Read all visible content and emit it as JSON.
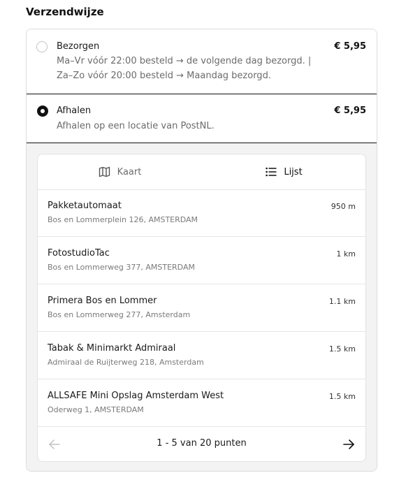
{
  "section_title": "Verzendwijze",
  "options": [
    {
      "label": "Bezorgen",
      "price": "€ 5,95",
      "description_line1": "Ma–Vr vóór 22:00 besteld → de volgende dag bezorgd. |",
      "description_line2": "Za–Zo vóór 20:00 besteld → Maandag bezorgd.",
      "selected": false
    },
    {
      "label": "Afhalen",
      "price": "€ 5,95",
      "description": "Afhalen op een locatie van PostNL.",
      "selected": true
    }
  ],
  "tabs": {
    "map": {
      "label": "Kaart",
      "icon": "map-icon"
    },
    "list": {
      "label": "Lijst",
      "icon": "list-icon",
      "active": true
    }
  },
  "locations": [
    {
      "name": "Pakketautomaat",
      "address": "Bos en Lommerplein 126, AMSTERDAM",
      "distance": "950 m"
    },
    {
      "name": "FotostudioTac",
      "address": "Bos en Lommerweg 377, AMSTERDAM",
      "distance": "1 km"
    },
    {
      "name": "Primera Bos en Lommer",
      "address": "Bos en Lommerweg 277, Amsterdam",
      "distance": "1.1 km"
    },
    {
      "name": "Tabak & Minimarkt Admiraal",
      "address": "Admiraal de Ruijterweg 218, Amsterdam",
      "distance": "1.5 km"
    },
    {
      "name": "ALLSAFE Mini Opslag Amsterdam West",
      "address": "Oderweg 1, AMSTERDAM",
      "distance": "1.5 km"
    }
  ],
  "pagination": {
    "text": "1 - 5 van 20 punten",
    "prev_enabled": false,
    "next_enabled": true
  },
  "colors": {
    "text": "#1a1a1a",
    "muted": "#6b6b6b",
    "border": "#dcdcdc",
    "selected_border": "#111111",
    "panel_bg": "#f3f3f3"
  }
}
